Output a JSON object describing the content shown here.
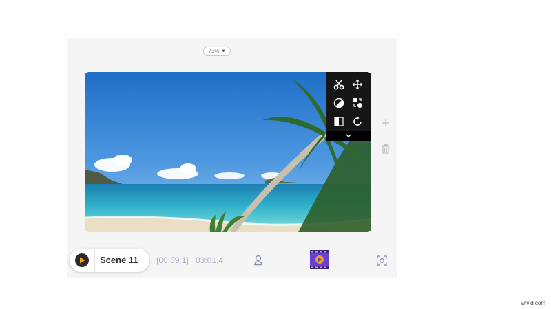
{
  "zoom": {
    "level": "73%",
    "caret_icon": "caret-down-icon"
  },
  "preview": {
    "scene_description_alt": ""
  },
  "toolbar": {
    "tools": [
      "scissors-icon",
      "move-icon",
      "contrast-icon",
      "swap-layers-icon",
      "split-mirror-icon",
      "rotate-icon"
    ],
    "expand_icon": "chevron-down-icon"
  },
  "side_actions": {
    "add_icon": "plus-icon",
    "delete_icon": "trash-icon"
  },
  "scene": {
    "play_icon": "play-icon",
    "title": "Scene 11"
  },
  "timing": {
    "start": "[00:59.1]",
    "total": "03:01.4"
  },
  "bottom_icons": {
    "avatar": "user-avatar-icon",
    "media": "film-clip-icon",
    "capture": "screen-capture-icon"
  },
  "colors": {
    "panel_bg": "#f5f5f5",
    "toolbar_bg": "#161616",
    "accent_purple": "#6a3fd2",
    "accent_orange": "#f2a11b",
    "time_text": "#a8aec4"
  },
  "watermark": {
    "text": "wtvid.com"
  }
}
